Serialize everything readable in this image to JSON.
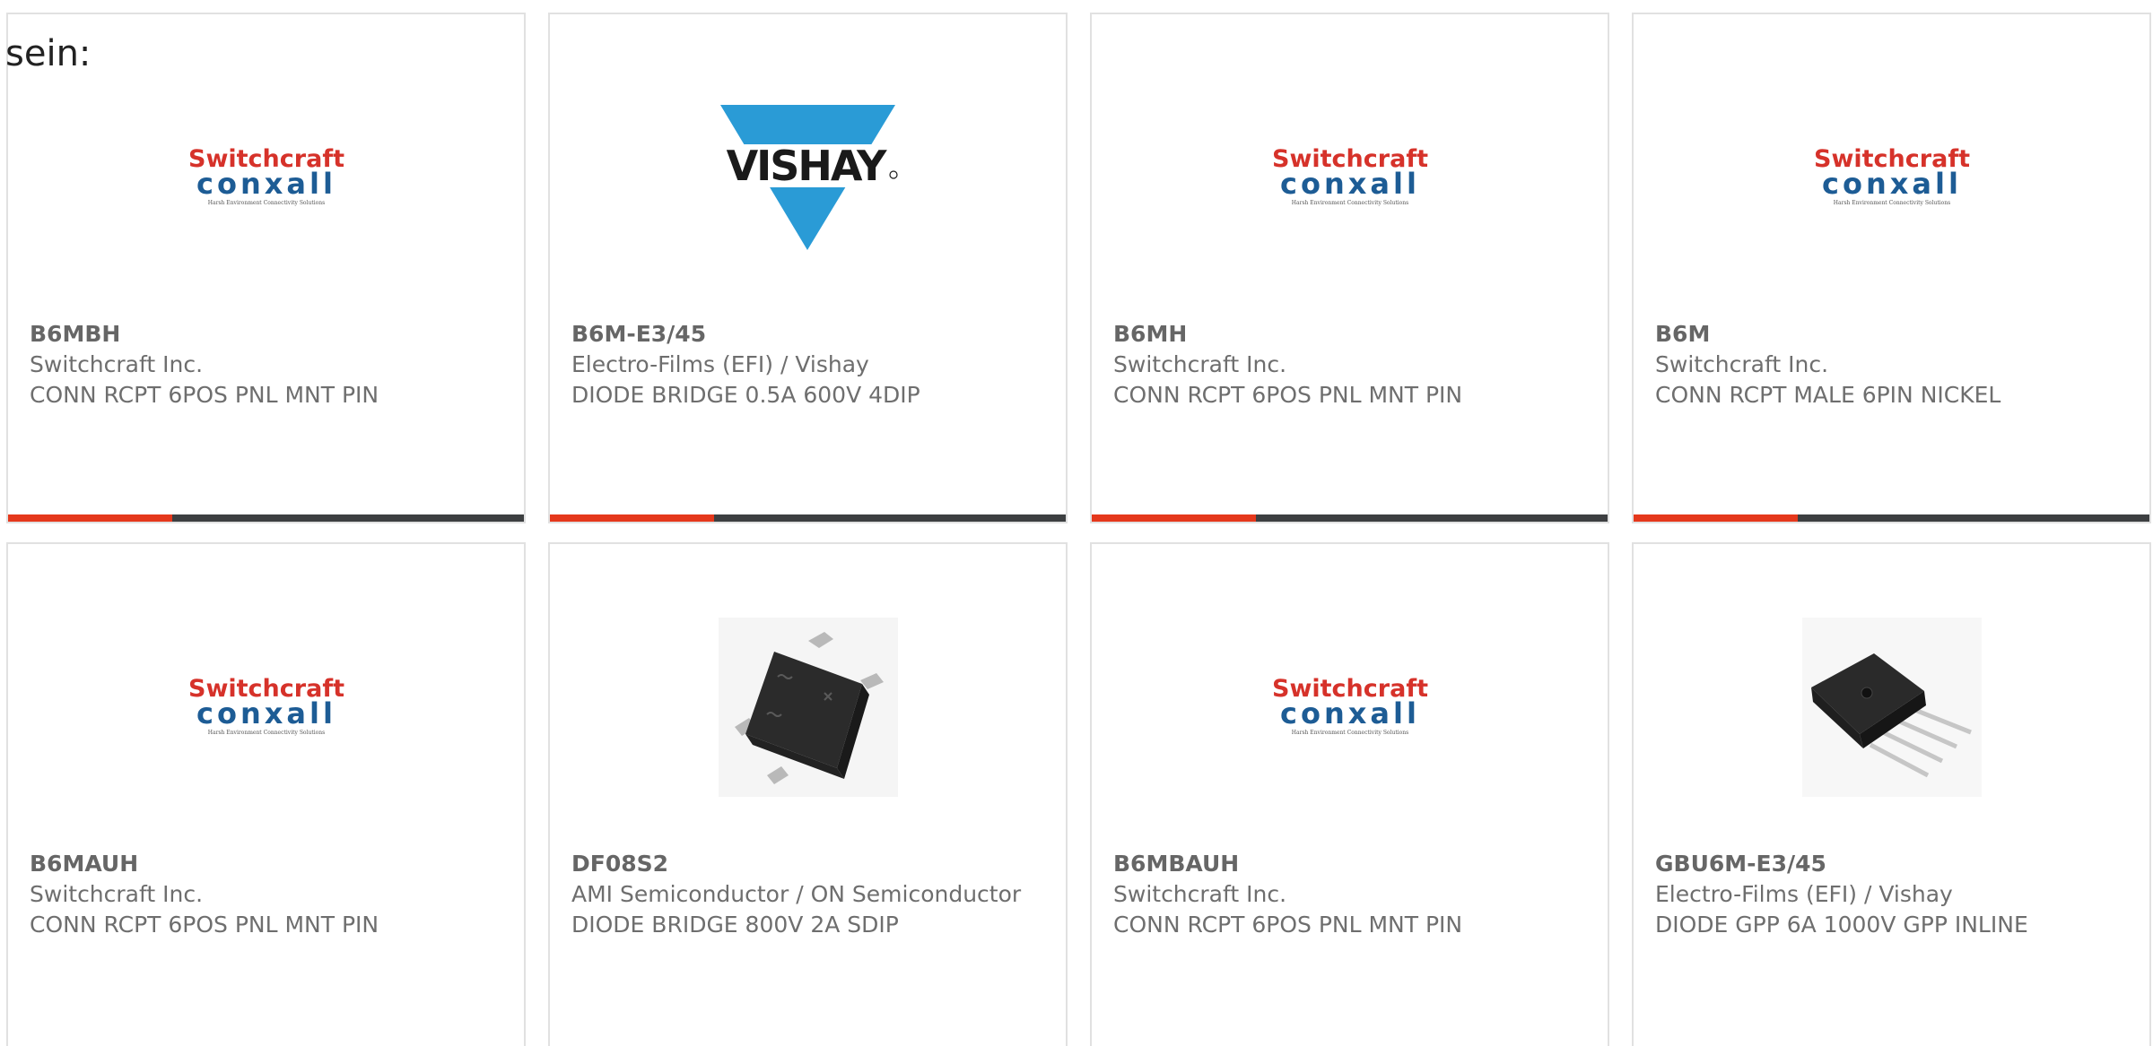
{
  "intro_text": "sein:",
  "colors": {
    "accent": "#e5381c",
    "bar_dark": "#3d3f41",
    "switchcraft_red": "#d6322a",
    "conxall_blue": "#1d5c95",
    "vishay_blue": "#2a9bd6"
  },
  "logos": {
    "switchcraft": {
      "brand": "Switchcraft",
      "sub": "conxall",
      "tagline": "Harsh Environment Connectivity Solutions"
    },
    "vishay": {
      "brand": "VISHAY"
    }
  },
  "products": [
    {
      "part_number": "B6MBH",
      "manufacturer": "Switchcraft Inc.",
      "description": "CONN RCPT 6POS PNL MNT PIN",
      "image": "switchcraft-logo"
    },
    {
      "part_number": "B6M-E3/45",
      "manufacturer": "Electro-Films (EFI) / Vishay",
      "description": "DIODE BRIDGE 0.5A 600V 4DIP",
      "image": "vishay-logo"
    },
    {
      "part_number": "B6MH",
      "manufacturer": "Switchcraft Inc.",
      "description": "CONN RCPT 6POS PNL MNT PIN",
      "image": "switchcraft-logo"
    },
    {
      "part_number": "B6M",
      "manufacturer": "Switchcraft Inc.",
      "description": "CONN RCPT MALE 6PIN NICKEL",
      "image": "switchcraft-logo"
    },
    {
      "part_number": "B6MAUH",
      "manufacturer": "Switchcraft Inc.",
      "description": "CONN RCPT 6POS PNL MNT PIN",
      "image": "switchcraft-logo"
    },
    {
      "part_number": "DF08S2",
      "manufacturer": "AMI Semiconductor / ON Semiconductor",
      "description": "DIODE BRIDGE 800V 2A SDIP",
      "image": "smd-bridge-chip"
    },
    {
      "part_number": "B6MBAUH",
      "manufacturer": "Switchcraft Inc.",
      "description": "CONN RCPT 6POS PNL MNT PIN",
      "image": "switchcraft-logo"
    },
    {
      "part_number": "GBU6M-E3/45",
      "manufacturer": "Electro-Films (EFI) / Vishay",
      "description": "DIODE GPP 6A 1000V GPP INLINE",
      "image": "inline-bridge-chip"
    }
  ]
}
